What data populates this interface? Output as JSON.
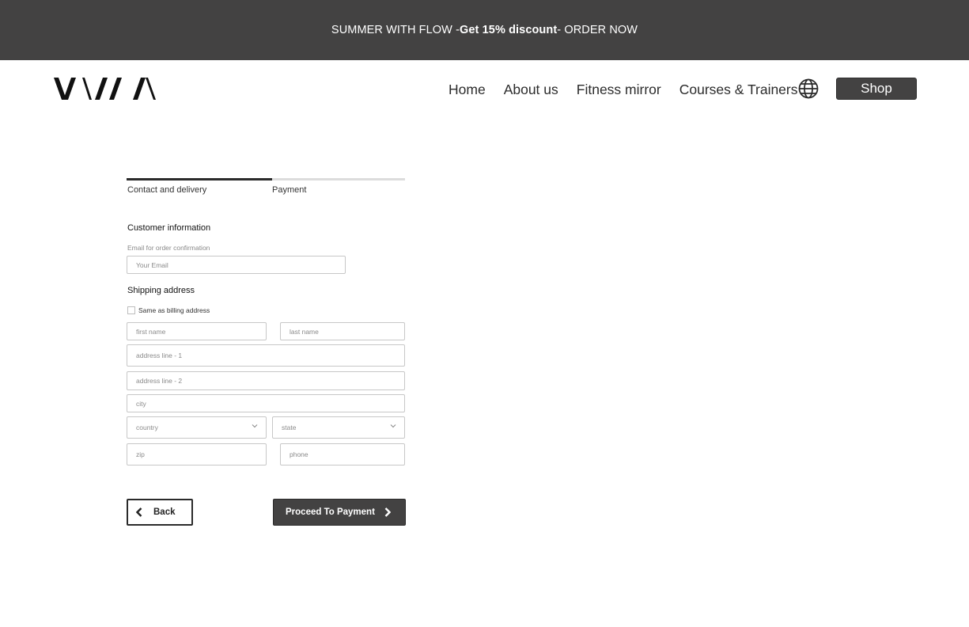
{
  "promo": {
    "prefix": "SUMMER WITH FLOW - ",
    "highlight": "Get 15% discount",
    "suffix": " - ORDER NOW"
  },
  "header": {
    "logo_icon": "brand-logo-icon",
    "nav": [
      "Home",
      "About us",
      "Fitness mirror",
      "Courses & Trainers"
    ],
    "language_icon": "globe-icon",
    "shop_label": "Shop"
  },
  "stepper": {
    "steps": [
      "Contact and delivery",
      "Payment"
    ],
    "active_step": 1
  },
  "customer": {
    "title": "Customer information",
    "email_label": "Email for order confirmation",
    "email_placeholder": "Your Email"
  },
  "shipping": {
    "title": "Shipping address",
    "same_as_billing_label": "Same as billing address",
    "same_as_billing_checked": false,
    "first_name_placeholder": "first name",
    "last_name_placeholder": "last name",
    "address1_placeholder": "address line - 1",
    "address2_placeholder": "address line - 2",
    "city_placeholder": "city",
    "country_placeholder": "country",
    "state_placeholder": "state",
    "zip_placeholder": "zip",
    "phone_placeholder": "phone"
  },
  "actions": {
    "back_label": "Back",
    "proceed_label": "Proceed To Payment"
  },
  "colors": {
    "dark": "#434242",
    "border": "#c7c7c7",
    "placeholder": "#8a8a8a"
  }
}
